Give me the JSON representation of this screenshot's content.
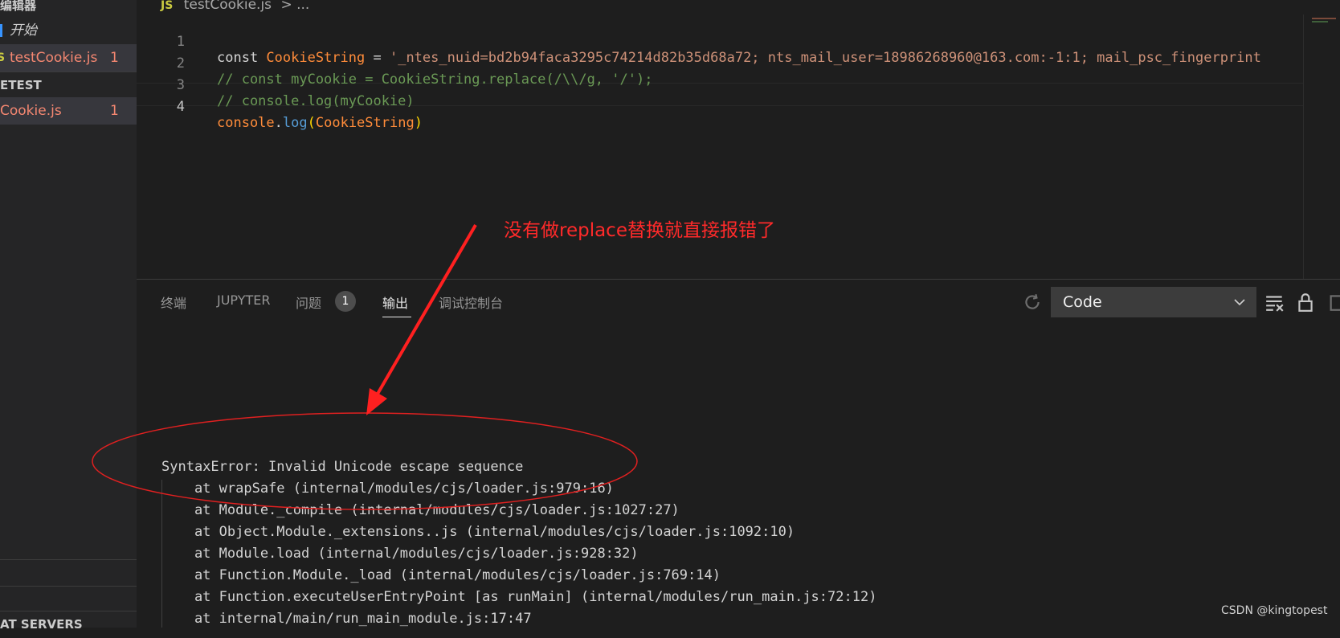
{
  "sidebar": {
    "header_editors": "编辑器",
    "welcome": "开始",
    "open_file": "testCookie.js",
    "open_file_count": "1",
    "folder": "ETEST",
    "folder_file": "Cookie.js",
    "folder_file_count": "1",
    "section_bottom": "AT SERVERS"
  },
  "breadcrumb": {
    "file": "testCookie.js",
    "rest": "> ..."
  },
  "editor": {
    "lines": [
      {
        "number": "1",
        "parts": [
          "const ",
          "CookieString",
          " = ",
          "'_ntes_nuid=bd2b94faca3295c74214d82b35d68a72; nts_mail_user=18986268960@163.com:-1:1; mail_psc_fingerprint"
        ]
      },
      {
        "number": "2",
        "text": "// const myCookie = CookieString.replace(/\\\\/g, '/');"
      },
      {
        "number": "3",
        "text": "// console.log(myCookie)"
      },
      {
        "number": "4",
        "parts": [
          "console",
          ".",
          "log",
          "(",
          "CookieString",
          ")"
        ]
      }
    ]
  },
  "annotation": "没有做replace替换就直接报错了",
  "panel": {
    "tabs": [
      "终端",
      "JUPYTER",
      "问题",
      "输出",
      "调试控制台"
    ],
    "problems_badge": "1",
    "active_tab": "输出",
    "output_channel": "Code"
  },
  "output": {
    "lines": [
      "SyntaxError: Invalid Unicode escape sequence",
      "    at wrapSafe (internal/modules/cjs/loader.js:979:16)",
      "    at Module._compile (internal/modules/cjs/loader.js:1027:27)",
      "    at Object.Module._extensions..js (internal/modules/cjs/loader.js:1092:10)",
      "    at Module.load (internal/modules/cjs/loader.js:928:32)",
      "    at Function.Module._load (internal/modules/cjs/loader.js:769:14)",
      "    at Function.executeUserEntryPoint [as runMain] (internal/modules/run_main.js:72:12)",
      "    at internal/main/run_main_module.js:17:47"
    ]
  },
  "watermark": "CSDN @kingtopest",
  "colors": {
    "annotation": "#ff2a2a",
    "variable": "#ff8c3a",
    "comment": "#6a9955",
    "error_file": "#f48771"
  }
}
